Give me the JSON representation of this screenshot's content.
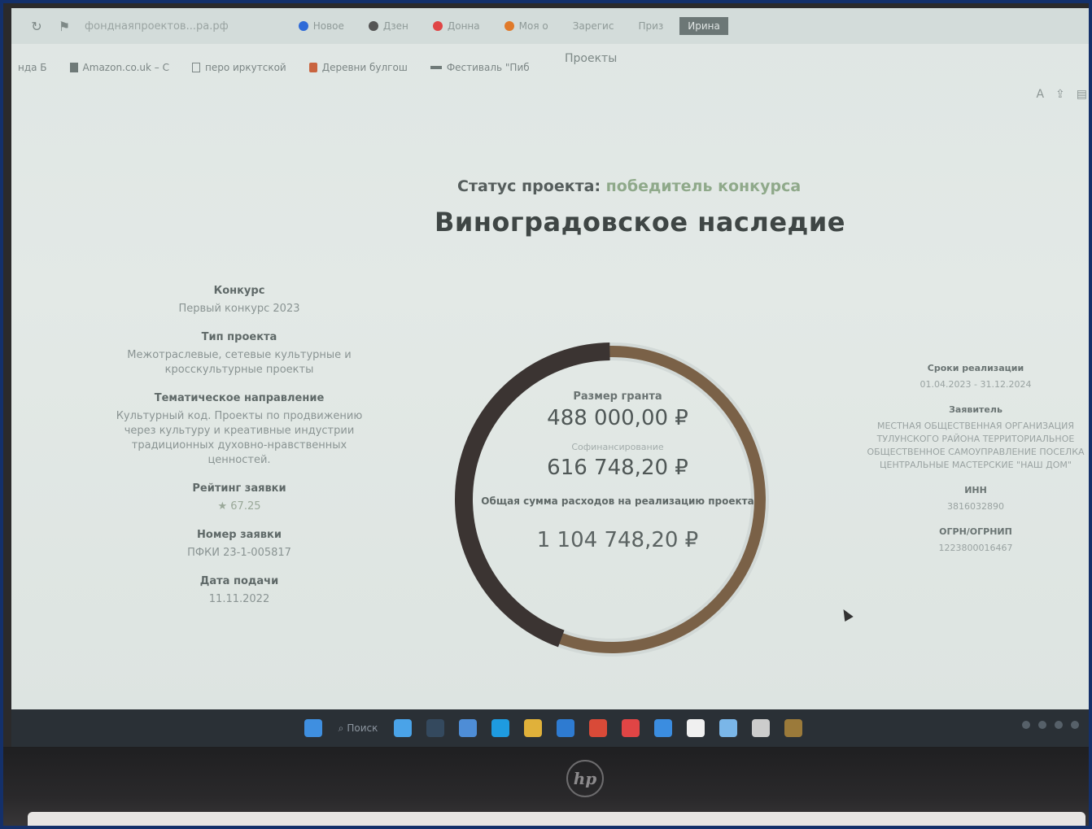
{
  "browser": {
    "url": "фонднаяпроектов...ра.рф",
    "tabs": [
      {
        "label": "Новое",
        "color": "#2f6bd8"
      },
      {
        "label": "Дзен",
        "color": "#555555"
      },
      {
        "label": "Донна",
        "color": "#e04545"
      },
      {
        "label": "Моя о",
        "color": "#e07a2a"
      },
      {
        "label": "Зарегис",
        "color": "#6c7776"
      },
      {
        "label": "Приз",
        "color": "#6c7776"
      },
      {
        "label": "Ирина",
        "color": "#6c7776"
      }
    ],
    "page_label": "Проекты",
    "bookmarks": [
      {
        "label": "Amazon.co.uk – С"
      },
      {
        "label": "перо иркутской"
      },
      {
        "label": "Деревни булгош"
      },
      {
        "label": "Фестиваль \"Пиб"
      }
    ],
    "bookmark_prefix": "нда Б"
  },
  "project": {
    "status_label": "Статус проекта:",
    "status_value": "победитель конкурса",
    "title": "Виноградовское наследие"
  },
  "left_info": [
    {
      "label": "Конкурс",
      "value": "Первый конкурс 2023"
    },
    {
      "label": "Тип проекта",
      "value": "Межотраслевые, сетевые культурные и кросскультурные проекты"
    },
    {
      "label": "Тематическое направление",
      "value": "Культурный код. Проекты по продвижению через культуру и креативные индустрии традиционных духовно-нравственных ценностей."
    },
    {
      "label": "Рейтинг заявки",
      "value": "67.25"
    },
    {
      "label": "Номер заявки",
      "value": "ПФКИ 23-1-005817"
    },
    {
      "label": "Дата подачи",
      "value": "11.11.2022"
    }
  ],
  "right_info": [
    {
      "label": "Сроки реализации",
      "value": "01.04.2023 - 31.12.2024"
    },
    {
      "label": "Заявитель",
      "value": "МЕСТНАЯ ОБЩЕСТВЕННАЯ ОРГАНИЗАЦИЯ ТУЛУНСКОГО РАЙОНА ТЕРРИТОРИАЛЬНОЕ ОБЩЕСТВЕННОЕ САМОУПРАВЛЕНИЕ ПОСЕЛКА ЦЕНТРАЛЬНЫЕ МАСТЕРСКИЕ \"НАШ ДОМ\""
    },
    {
      "label": "ИНН",
      "value": "3816032890"
    },
    {
      "label": "ОГРН/ОГРНИП",
      "value": "1223800016467"
    }
  ],
  "finance": {
    "grant_label": "Размер гранта",
    "grant_value": "488 000,00 ₽",
    "cofinancing_label": "Софинансирование",
    "cofinancing_value": "616 748,20 ₽",
    "total_label": "Общая сумма расходов на реализацию проекта",
    "total_value": "1 104 748,20 ₽",
    "grant_share": 0.442,
    "colors": {
      "grant": "#3b3432",
      "cofinancing": "#7a6147"
    }
  },
  "taskbar": {
    "search_label": "Поиск",
    "apps": [
      "#4aa3e8",
      "#34495e",
      "#4e8dd6",
      "#1e9be0",
      "#e0b13a",
      "#2e7bd1",
      "#d94a38",
      "#e04545",
      "#3b8de0",
      "#f0f0f0",
      "#7ab6e8",
      "#cccccc",
      "#9b7a3a"
    ]
  },
  "device": {
    "brand": "hp"
  }
}
